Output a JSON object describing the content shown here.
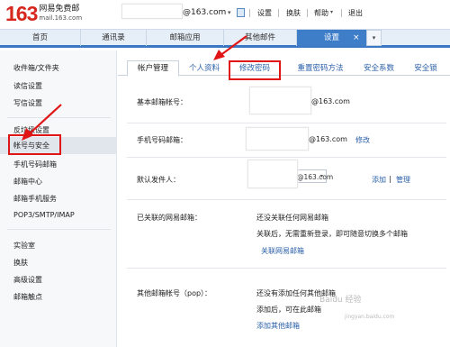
{
  "header": {
    "logo_number": "163",
    "logo_title": "网易免费邮",
    "logo_domain": "mail.163.com",
    "user_domain": "@163.com",
    "caret": "▾",
    "links": [
      "设置",
      "换肤",
      "帮助",
      "退出"
    ]
  },
  "tabs": [
    {
      "label": "首页"
    },
    {
      "label": "通讯录"
    },
    {
      "label": "邮箱应用"
    },
    {
      "label": "其他邮件"
    },
    {
      "label": "设置",
      "active": true
    }
  ],
  "tab_close": "×",
  "tab_menu": "▾",
  "sidebar": {
    "items": [
      "收件箱/文件夹",
      "读信设置",
      "写信设置",
      "反垃圾设置",
      "帐号与安全",
      "手机号码邮箱",
      "邮箱中心",
      "邮箱手机服务",
      "POP3/SMTP/IMAP",
      "实验室",
      "换肤",
      "高级设置",
      "邮箱触点"
    ],
    "active_index": 4
  },
  "content_tabs": [
    "帐户管理",
    "个人资料",
    "修改密码",
    "重置密码方法",
    "安全系数",
    "安全锁"
  ],
  "fields": {
    "basic_label": "基本邮箱帐号：",
    "basic_suffix": "@163.com",
    "phone_label": "手机号码邮箱：",
    "phone_suffix": "@163.com",
    "phone_action": "修改",
    "sender_label": "默认发件人：",
    "sender_value": "@163.com",
    "sender_add": "添加",
    "sender_sep": "|",
    "sender_manage": "管理",
    "linked_label": "已关联的网易邮箱：",
    "linked_text1": "还没关联任何网易邮箱",
    "linked_text2": "关联后，无需重新登录，即可随意切换多个邮箱",
    "linked_action": "关联网易邮箱",
    "pop_label": "其他邮箱帐号（pop）：",
    "pop_text1": "还没有添加任何其他邮箱",
    "pop_text2": "添加后，可在此邮箱",
    "pop_action": "添加其他邮箱"
  },
  "watermark": "Baidu 经验",
  "watermark_url": "jingyan.baidu.com",
  "colors": {
    "accent_blue": "#3e7dc8",
    "link_blue": "#2a5fa8",
    "highlight_red": "#e01515",
    "logo_red": "#d7281e"
  }
}
